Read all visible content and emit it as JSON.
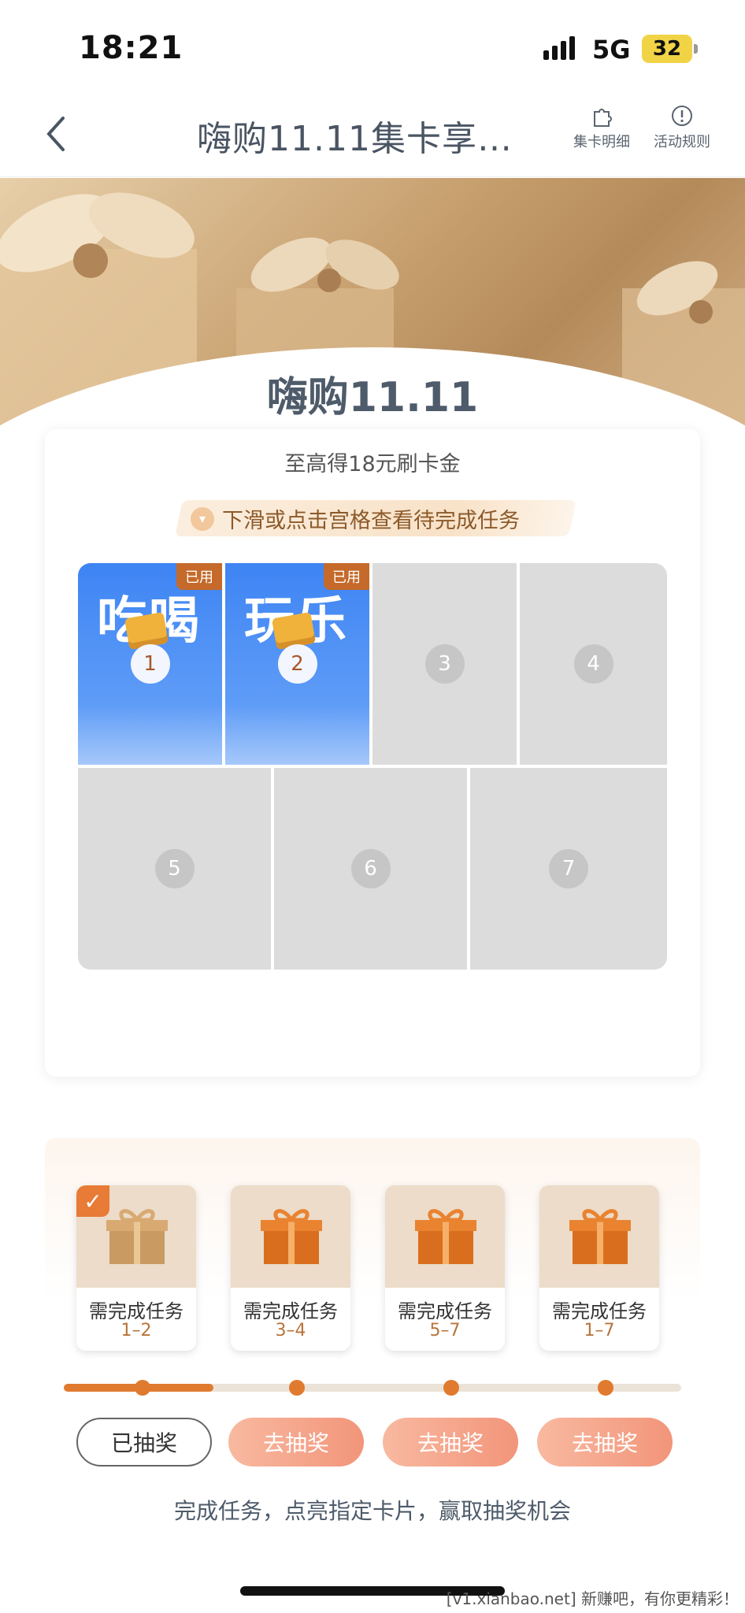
{
  "status_bar": {
    "time": "18:21",
    "network": "5G",
    "battery": "32"
  },
  "nav": {
    "title": "嗨购11.11集卡享…",
    "card_detail": "集卡明细",
    "rules": "活动规则"
  },
  "banner": {
    "title": "嗨购11.11"
  },
  "panel": {
    "subtitle": "至高得18元刷卡金",
    "hint": "下滑或点击宫格查看待完成任务",
    "cells": [
      {
        "num": "1",
        "text": "吃喝",
        "tag": "已用",
        "state": "active"
      },
      {
        "num": "2",
        "text": "玩乐",
        "tag": "已用",
        "state": "active"
      },
      {
        "num": "3",
        "state": "locked"
      },
      {
        "num": "4",
        "state": "locked"
      },
      {
        "num": "5",
        "state": "locked"
      },
      {
        "num": "6",
        "state": "locked"
      },
      {
        "num": "7",
        "state": "locked"
      }
    ]
  },
  "lottery": {
    "boxes": [
      {
        "label": "需完成任务",
        "range": "1–2",
        "checked": true
      },
      {
        "label": "需完成任务",
        "range": "3–4"
      },
      {
        "label": "需完成任务",
        "range": "5–7"
      },
      {
        "label": "需完成任务",
        "range": "1–7"
      }
    ],
    "buttons": [
      "已抽奖",
      "去抽奖",
      "去抽奖",
      "去抽奖"
    ],
    "footer": "完成任务，点亮指定卡片，赢取抽奖机会"
  },
  "watermark": "[v1.xianbao.net] 新赚吧，有你更精彩！",
  "colors": {
    "accent": "#e07a2e",
    "card_blue": "#3e84f3",
    "title_gray": "#4e5b6a"
  }
}
